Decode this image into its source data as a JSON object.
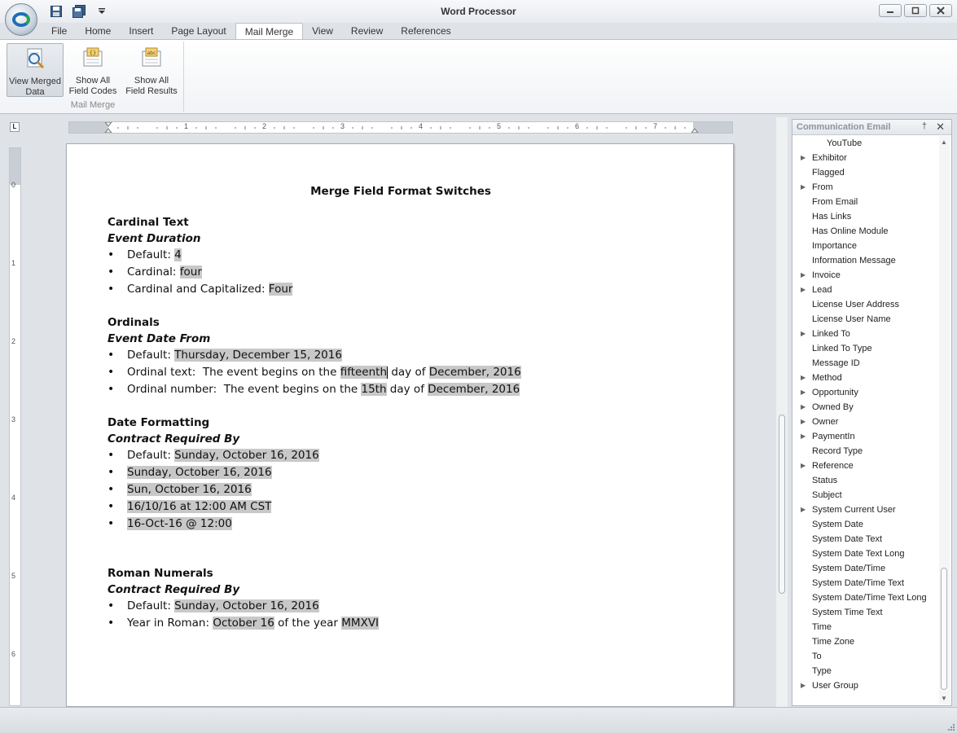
{
  "window": {
    "title": "Word Processor"
  },
  "tabs": [
    "File",
    "Home",
    "Insert",
    "Page Layout",
    "Mail Merge",
    "View",
    "Review",
    "References"
  ],
  "active_tab": "Mail Merge",
  "ribbon": {
    "group_label": "Mail Merge",
    "buttons": [
      {
        "line1": "View Merged",
        "line2": "Data",
        "icon": "magnifier-document-icon",
        "active": true
      },
      {
        "line1": "Show All",
        "line2": "Field Codes",
        "icon": "field-codes-icon",
        "active": false
      },
      {
        "line1": "Show All",
        "line2": "Field Results",
        "icon": "field-results-icon",
        "active": false
      }
    ]
  },
  "ruler": {
    "corner": "L",
    "h_numbers": [
      "1",
      "2",
      "3",
      "4",
      "5",
      "6",
      "7"
    ],
    "v_numbers": [
      "0",
      "1",
      "2",
      "3",
      "4",
      "5",
      "6"
    ]
  },
  "document": {
    "title": "Merge Field Format Switches",
    "cardinal": {
      "title": "Cardinal Text",
      "sub": "Event Duration",
      "default_label": "Default: ",
      "default_value": "4",
      "cardinal_label": "Cardinal: ",
      "cardinal_value": "four",
      "cap_label": "Cardinal and Capitalized: ",
      "cap_value": "Four"
    },
    "ordinals": {
      "title": "Ordinals",
      "sub": "Event Date From",
      "default_label": "Default: ",
      "default_value": "Thursday, December 15, 2016",
      "text_label": "Ordinal text:  The event begins on the ",
      "text_value": "fifteenth",
      "text_mid": " day of ",
      "text_month": "December, 2016",
      "num_label": "Ordinal number:  The event begins on the ",
      "num_value": "15th",
      "num_mid": " day of ",
      "num_month": "December, 2016"
    },
    "dates": {
      "title": "Date Formatting",
      "sub": "Contract Required By",
      "default_label": "Default: ",
      "default_value": "Sunday, October 16, 2016",
      "f1": "Sunday, October 16, 2016",
      "f2": "Sun, October 16, 2016",
      "f3": "16/10/16 at 12:00 AM CST",
      "f4": "16-Oct-16 @ 12:00"
    },
    "roman": {
      "title": "Roman Numerals",
      "sub": "Contract Required By",
      "default_label": "Default: ",
      "default_value": "Sunday, October 16, 2016",
      "year_label": "Year in Roman: ",
      "year_date": "October 16",
      "year_mid": " of the year ",
      "year_value": "MMXVI"
    }
  },
  "panel": {
    "title": "Communication Email",
    "pin": "†",
    "close": "✕",
    "items": [
      {
        "label": "YouTube",
        "expandable": false,
        "child": true
      },
      {
        "label": "Exhibitor",
        "expandable": true
      },
      {
        "label": "Flagged",
        "expandable": false
      },
      {
        "label": "From",
        "expandable": true
      },
      {
        "label": "From Email",
        "expandable": false
      },
      {
        "label": "Has Links",
        "expandable": false
      },
      {
        "label": "Has Online Module",
        "expandable": false
      },
      {
        "label": "Importance",
        "expandable": false
      },
      {
        "label": "Information Message",
        "expandable": false
      },
      {
        "label": "Invoice",
        "expandable": true
      },
      {
        "label": "Lead",
        "expandable": true
      },
      {
        "label": "License User Address",
        "expandable": false
      },
      {
        "label": "License User Name",
        "expandable": false
      },
      {
        "label": "Linked To",
        "expandable": true
      },
      {
        "label": "Linked To Type",
        "expandable": false
      },
      {
        "label": "Message ID",
        "expandable": false
      },
      {
        "label": "Method",
        "expandable": true
      },
      {
        "label": "Opportunity",
        "expandable": true
      },
      {
        "label": "Owned By",
        "expandable": true
      },
      {
        "label": "Owner",
        "expandable": true
      },
      {
        "label": "PaymentIn",
        "expandable": true
      },
      {
        "label": "Record Type",
        "expandable": false
      },
      {
        "label": "Reference",
        "expandable": true
      },
      {
        "label": "Status",
        "expandable": false
      },
      {
        "label": "Subject",
        "expandable": false
      },
      {
        "label": "System Current User",
        "expandable": true
      },
      {
        "label": "System Date",
        "expandable": false
      },
      {
        "label": "System Date Text",
        "expandable": false
      },
      {
        "label": "System Date Text Long",
        "expandable": false
      },
      {
        "label": "System Date/Time",
        "expandable": false
      },
      {
        "label": "System Date/Time Text",
        "expandable": false
      },
      {
        "label": "System Date/Time Text Long",
        "expandable": false
      },
      {
        "label": "System Time Text",
        "expandable": false
      },
      {
        "label": "Time",
        "expandable": false
      },
      {
        "label": "Time Zone",
        "expandable": false
      },
      {
        "label": "To",
        "expandable": false
      },
      {
        "label": "Type",
        "expandable": false
      },
      {
        "label": "User Group",
        "expandable": true
      }
    ]
  }
}
